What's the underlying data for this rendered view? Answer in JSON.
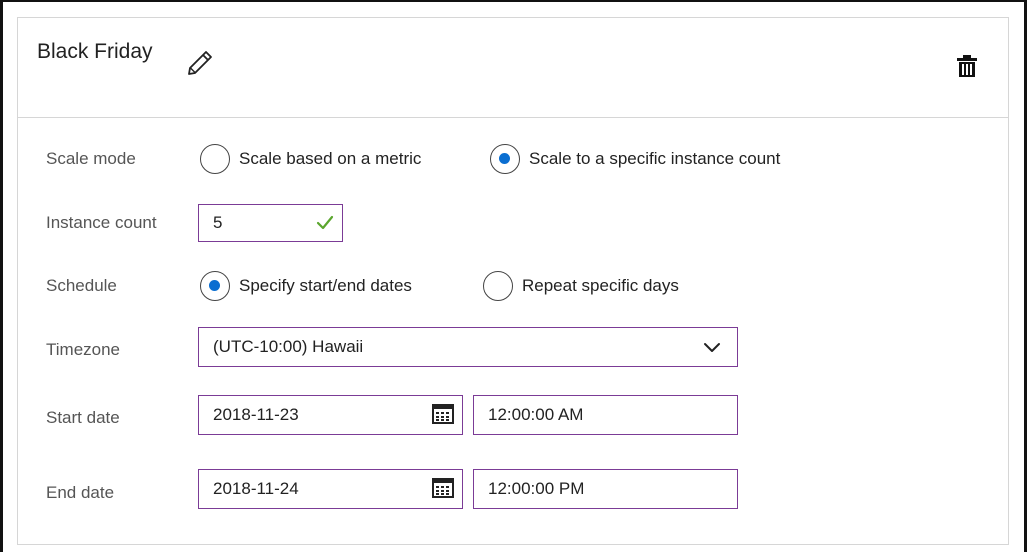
{
  "header": {
    "title": "Black Friday",
    "edit_icon": "pencil-icon",
    "delete_icon": "trash-icon"
  },
  "scale_mode": {
    "label": "Scale mode",
    "options": [
      {
        "label": "Scale based on a metric",
        "selected": false
      },
      {
        "label": "Scale to a specific instance count",
        "selected": true
      }
    ]
  },
  "instance_count": {
    "label": "Instance count",
    "value": "5",
    "valid": true
  },
  "schedule": {
    "label": "Schedule",
    "options": [
      {
        "label": "Specify start/end dates",
        "selected": true
      },
      {
        "label": "Repeat specific days",
        "selected": false
      }
    ]
  },
  "timezone": {
    "label": "Timezone",
    "value": "(UTC-10:00) Hawaii"
  },
  "start": {
    "label": "Start date",
    "date": "2018-11-23",
    "time": "12:00:00 AM"
  },
  "end": {
    "label": "End date",
    "date": "2018-11-24",
    "time": "12:00:00 PM"
  },
  "colors": {
    "accent": "#7b3b96",
    "radio_selected": "#0a6ed1",
    "valid_check": "#5ba62e"
  }
}
